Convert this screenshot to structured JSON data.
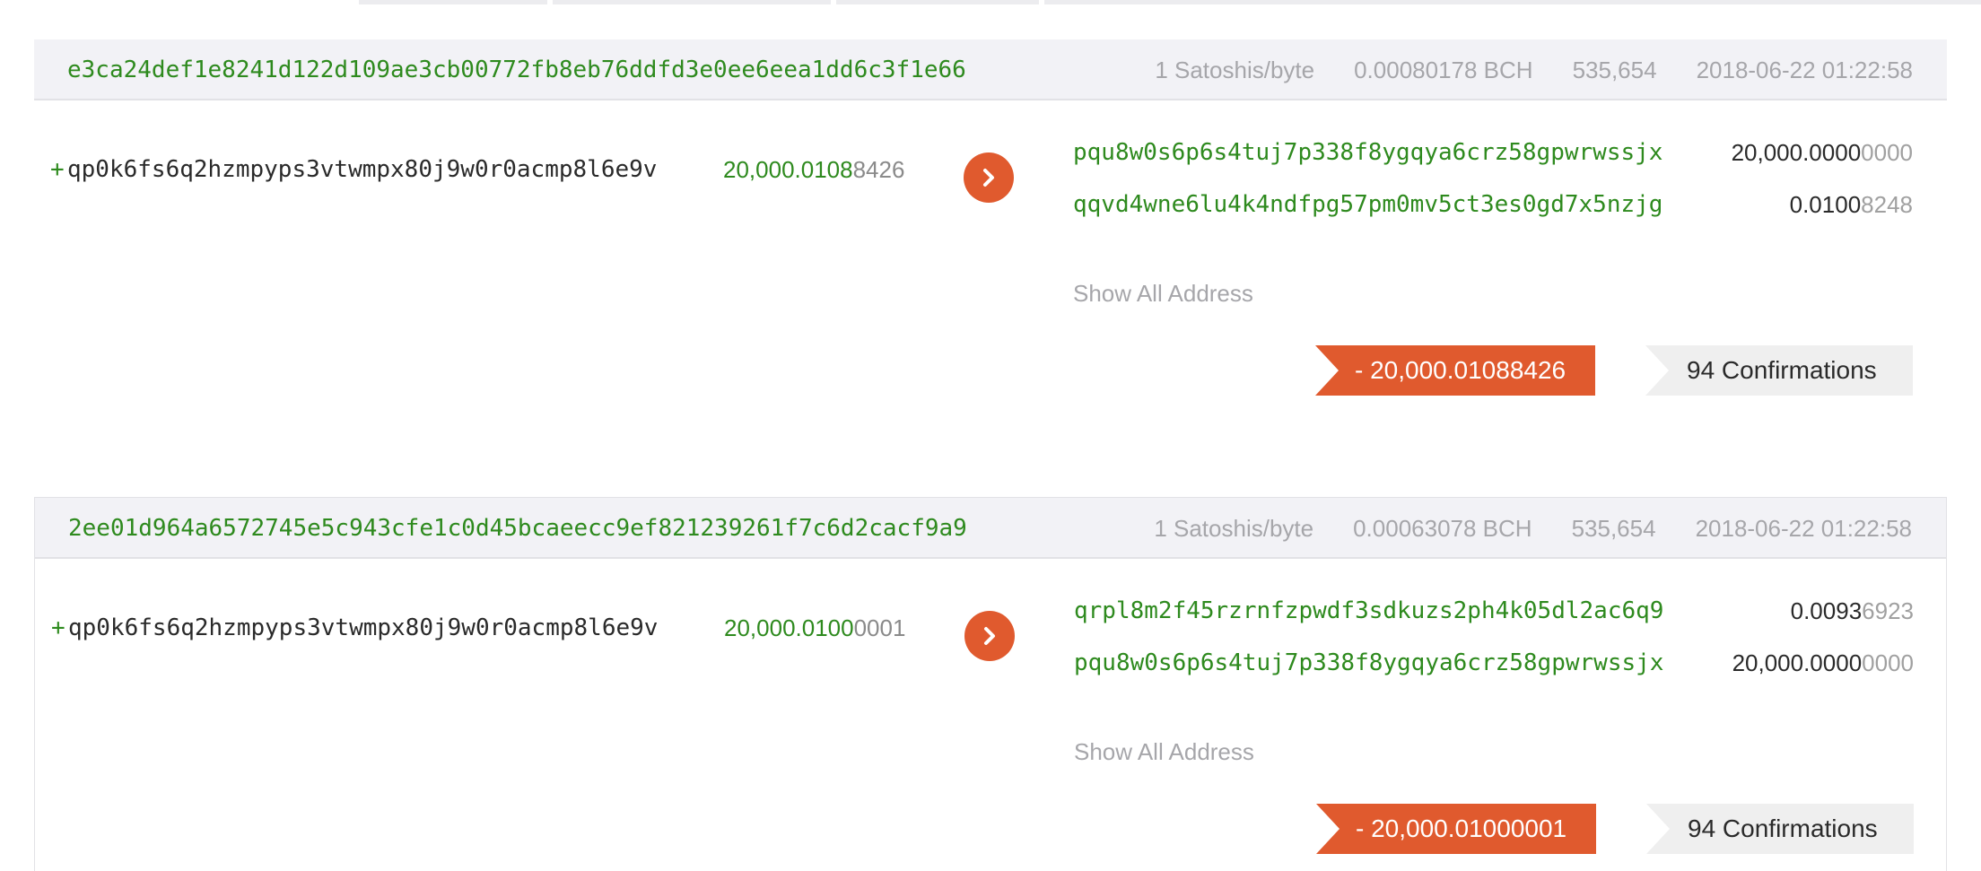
{
  "transactions": [
    {
      "hash": "e3ca24def1e8241d122d109ae3cb00772fb8eb76ddfd3e0ee6eea1dd6c3f1e66",
      "fee_rate": "1 Satoshis/byte",
      "fee": "0.00080178 BCH",
      "block": "535,654",
      "time": "2018-06-22 01:22:58",
      "input": {
        "prefix": "+",
        "address": "qp0k6fs6q2hzmpyps3vtwmpx80j9w0r0acmp8l6e9v",
        "amount_main": "20,000.0108",
        "amount_tail": "8426"
      },
      "outputs": [
        {
          "address": "pqu8w0s6p6s4tuj7p338f8ygqya6crz58gpwrwssjx",
          "amount_main": "20,000.0000",
          "amount_tail": "0000"
        },
        {
          "address": "qqvd4wne6lu4k4ndfpg57pm0mv5ct3es0gd7x5nzjg",
          "amount_main": "0.0100",
          "amount_tail": "8248"
        }
      ],
      "show_all_label": "Show All Address",
      "net_amount": "- 20,000.01088426",
      "confirmations": "94 Confirmations"
    },
    {
      "hash": "2ee01d964a6572745e5c943cfe1c0d45bcaeecc9ef821239261f7c6d2cacf9a9",
      "fee_rate": "1 Satoshis/byte",
      "fee": "0.00063078 BCH",
      "block": "535,654",
      "time": "2018-06-22 01:22:58",
      "input": {
        "prefix": "+",
        "address": "qp0k6fs6q2hzmpyps3vtwmpx80j9w0r0acmp8l6e9v",
        "amount_main": "20,000.0100",
        "amount_tail": "0001"
      },
      "outputs": [
        {
          "address": "qrpl8m2f45rzrnfzpwdf3sdkuzs2ph4k05dl2ac6q9",
          "amount_main": "0.0093",
          "amount_tail": "6923"
        },
        {
          "address": "pqu8w0s6p6s4tuj7p338f8ygqya6crz58gpwrwssjx",
          "amount_main": "20,000.0000",
          "amount_tail": "0000"
        }
      ],
      "show_all_label": "Show All Address",
      "net_amount": "- 20,000.01000001",
      "confirmations": "94 Confirmations"
    }
  ],
  "colors": {
    "accent_orange": "#e05a2e",
    "address_green": "#2e8a1e",
    "meta_gray": "#a6a6aa"
  },
  "icons": {
    "direction": "chevron-right-icon"
  }
}
